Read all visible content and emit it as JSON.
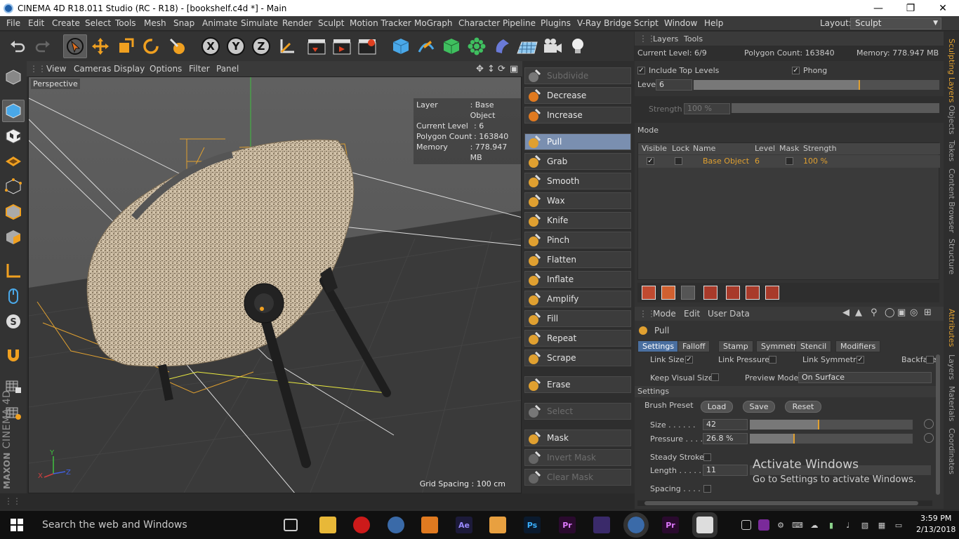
{
  "titlebar": {
    "title": "CINEMA 4D R18.011 Studio (RC - R18) - [bookshelf.c4d *] - Main"
  },
  "menu": [
    "File",
    "Edit",
    "Create",
    "Select",
    "Tools",
    "Mesh",
    "Snap",
    "Animate",
    "Simulate",
    "Render",
    "Sculpt",
    "Motion Tracker",
    "MoGraph",
    "Character",
    "Pipeline",
    "Plugins",
    "V-Ray Bridge",
    "Script",
    "Window",
    "Help"
  ],
  "layout": {
    "label": "Layout:",
    "value": "Sculpt"
  },
  "viewport": {
    "menu": [
      "View",
      "Cameras",
      "Display",
      "Options",
      "Filter",
      "Panel"
    ],
    "label": "Perspective",
    "hud": [
      {
        "k": "Layer",
        "v": ": Base Object"
      },
      {
        "k": "Current Level",
        "v": ": 6"
      },
      {
        "k": "Polygon Count",
        "v": ": 163840"
      },
      {
        "k": "Memory",
        "v": ": 778.947 MB"
      }
    ],
    "grid_spacing": "Grid Spacing : 100 cm",
    "axis": {
      "x": "X",
      "y": "Y",
      "z": "Z"
    }
  },
  "brushes": [
    {
      "label": "Subdivide",
      "state": "disabled"
    },
    {
      "label": "Decrease",
      "state": "normal"
    },
    {
      "label": "Increase",
      "state": "normal"
    },
    {
      "label": "Pull",
      "state": "selected"
    },
    {
      "label": "Grab",
      "state": "normal"
    },
    {
      "label": "Smooth",
      "state": "normal"
    },
    {
      "label": "Wax",
      "state": "normal"
    },
    {
      "label": "Knife",
      "state": "normal"
    },
    {
      "label": "Pinch",
      "state": "normal"
    },
    {
      "label": "Flatten",
      "state": "normal"
    },
    {
      "label": "Inflate",
      "state": "normal"
    },
    {
      "label": "Amplify",
      "state": "normal"
    },
    {
      "label": "Fill",
      "state": "normal"
    },
    {
      "label": "Repeat",
      "state": "normal"
    },
    {
      "label": "Scrape",
      "state": "normal"
    },
    {
      "label": "Erase",
      "state": "normal"
    },
    {
      "label": "Select",
      "state": "disabled"
    },
    {
      "label": "Mask",
      "state": "normal"
    },
    {
      "label": "Invert Mask",
      "state": "disabled"
    },
    {
      "label": "Clear Mask",
      "state": "disabled"
    }
  ],
  "layers": {
    "tabs": [
      "Layers",
      "Tools"
    ],
    "current_level": "Current Level: 6/9",
    "polygon_count": "Polygon Count: 163840",
    "memory": "Memory: 778.947 MB",
    "include_top_levels": "Include Top Levels",
    "phong": "Phong",
    "level_label": "Level",
    "level_value": "6",
    "strength_label": "Strength",
    "strength_value": "100 %",
    "mode_label": "Mode",
    "columns": [
      "Visible",
      "Lock",
      "Name",
      "Level",
      "Mask",
      "Strength"
    ],
    "row": {
      "name": "Base Object",
      "level": "6",
      "strength": "100 %"
    }
  },
  "attributes": {
    "menu": [
      "Mode",
      "Edit",
      "User Data"
    ],
    "title": "Pull",
    "tabs": [
      "Settings",
      "Falloff",
      "Stamp",
      "Symmetry",
      "Stencil",
      "Modifiers"
    ],
    "link_size": "Link Size",
    "link_pressure": "Link Pressure",
    "link_symmetry": "Link Symmetry",
    "backface": "Backface",
    "keep_visual_size": "Keep Visual Size",
    "preview_mode_label": "Preview Mode",
    "preview_mode_value": "On Surface",
    "settings_header": "Settings",
    "brush_preset": "Brush Preset",
    "load": "Load",
    "save": "Save",
    "reset": "Reset",
    "size_label": "Size . . . . . .",
    "size_value": "42",
    "size_fraction": 0.42,
    "pressure_label": "Pressure . . . .",
    "pressure_value": "26.8 %",
    "pressure_fraction": 0.268,
    "steady_stroke": "Steady Stroke",
    "length_label": "Length . . . . .",
    "length_value": "11",
    "spacing_label": "Spacing . . . ."
  },
  "side_tabs": [
    "Sculpting Layers",
    "Objects",
    "Takes",
    "Content Browser",
    "Structure",
    "Attributes",
    "Layers",
    "Materials",
    "Coordinates"
  ],
  "watermark": {
    "line1": "Activate Windows",
    "line2": "Go to Settings to activate Windows."
  },
  "taskbar": {
    "search": "Search the web and Windows",
    "time": "3:59 PM",
    "date": "2/13/2018",
    "apps": [
      "Ae",
      "Ps",
      "Pr",
      "Pr"
    ]
  },
  "colors": {
    "accent": "#e0a030",
    "selected": "#4a6fa0"
  }
}
